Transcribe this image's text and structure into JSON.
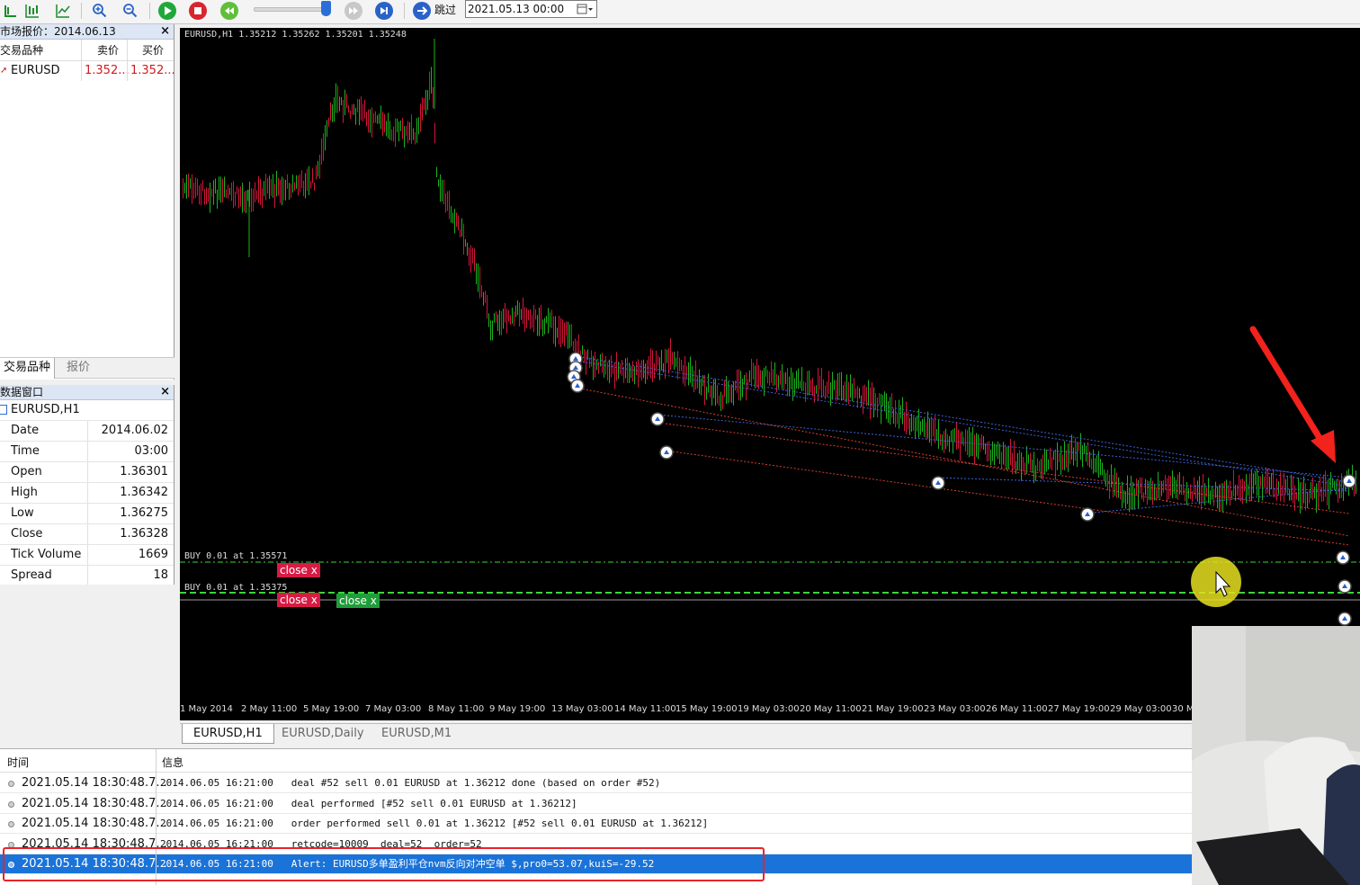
{
  "toolbar": {
    "skip_label": "跳过",
    "date_value": "2021.05.13 00:00"
  },
  "market_watch": {
    "title": "市场报价：2014.06.13",
    "headers": {
      "symbol": "交易品种",
      "bid": "卖价",
      "ask": "买价"
    },
    "rows": [
      {
        "symbol": "EURUSD",
        "bid": "1.352...",
        "ask": "1.352..."
      }
    ],
    "tabs": [
      "交易品种",
      "报价"
    ]
  },
  "data_window": {
    "title": "数据窗口",
    "symbol": "EURUSD,H1",
    "rows": [
      {
        "key": "Date",
        "value": "2014.06.02"
      },
      {
        "key": "Time",
        "value": "03:00"
      },
      {
        "key": "Open",
        "value": "1.36301"
      },
      {
        "key": "High",
        "value": "1.36342"
      },
      {
        "key": "Low",
        "value": "1.36275"
      },
      {
        "key": "Close",
        "value": "1.36328"
      },
      {
        "key": "Tick Volume",
        "value": "1669"
      },
      {
        "key": "Spread",
        "value": "18"
      }
    ]
  },
  "chart": {
    "header": "EURUSD,H1  1.35212 1.35262 1.35201 1.35248",
    "order_label_1": "BUY 0.01 at 1.35571",
    "order_label_2": "BUY 0.01 at 1.35375",
    "close_label": "close x",
    "time_labels": [
      "1 May 2014",
      "2 May 11:00",
      "5 May 19:00",
      "7 May 03:00",
      "8 May 11:00",
      "9 May 19:00",
      "13 May 03:00",
      "14 May 11:00",
      "15 May 19:00",
      "19 May 03:00",
      "20 May 11:00",
      "21 May 19:00",
      "23 May 03:00",
      "26 May 11:00",
      "27 May 19:00",
      "29 May 03:00",
      "30 M"
    ],
    "colors": {
      "bull": "#1db31d",
      "bear": "#d2163c",
      "buy_level": "#3ad53a"
    }
  },
  "chart_tabs": [
    "EURUSD,H1",
    "EURUSD,Daily",
    "EURUSD,M1"
  ],
  "journal": {
    "headers": {
      "time": "时间",
      "message": "信息"
    },
    "rows": [
      {
        "time": "2021.05.14 18:30:48.7...",
        "msg": "2014.06.05 16:21:00   deal #52 sell 0.01 EURUSD at 1.36212 done (based on order #52)"
      },
      {
        "time": "2021.05.14 18:30:48.7...",
        "msg": "2014.06.05 16:21:00   deal performed [#52 sell 0.01 EURUSD at 1.36212]"
      },
      {
        "time": "2021.05.14 18:30:48.7...",
        "msg": "2014.06.05 16:21:00   order performed sell 0.01 at 1.36212 [#52 sell 0.01 EURUSD at 1.36212]"
      },
      {
        "time": "2021.05.14 18:30:48.7...",
        "msg": "2014.06.05 16:21:00   retcode=10009  deal=52  order=52"
      },
      {
        "time": "2021.05.14 18:30:48.7...",
        "msg": "2014.06.05 16:21:00   Alert: EURUSD多单盈利平仓nvm反向对冲空单 $,pro0=53.07,kuiS=-29.52"
      }
    ]
  }
}
